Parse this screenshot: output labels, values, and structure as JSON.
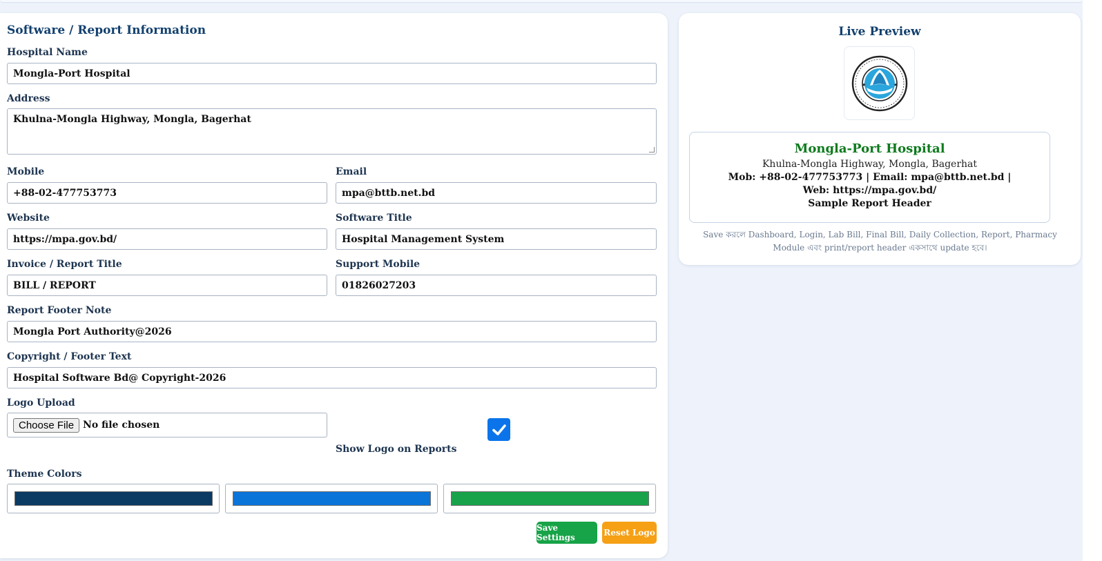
{
  "form": {
    "section_title": "Software / Report Information",
    "hospital_name": {
      "label": "Hospital Name",
      "value": "Mongla-Port Hospital"
    },
    "address": {
      "label": "Address",
      "value": "Khulna-Mongla Highway, Mongla, Bagerhat"
    },
    "mobile": {
      "label": "Mobile",
      "value": "+88-02-477753773"
    },
    "email": {
      "label": "Email",
      "value": "mpa@bttb.net.bd"
    },
    "website": {
      "label": "Website",
      "value": "https://mpa.gov.bd/"
    },
    "software_title": {
      "label": "Software Title",
      "value": "Hospital Management System"
    },
    "invoice_title": {
      "label": "Invoice / Report Title",
      "value": "BILL / REPORT"
    },
    "support_mobile": {
      "label": "Support Mobile",
      "value": "01826027203"
    },
    "footer_note": {
      "label": "Report Footer Note",
      "value": "Mongla Port Authority@2026"
    },
    "copyright": {
      "label": "Copyright / Footer Text",
      "value": "Hospital Software Bd@ Copyright-2026"
    },
    "logo_upload": {
      "label": "Logo Upload",
      "button": "Choose File",
      "status": "No file chosen"
    },
    "show_logo": {
      "label": "Show Logo on Reports",
      "checked": true
    },
    "theme_colors": {
      "label": "Theme Colors",
      "colors": [
        "#0b3a63",
        "#0b74d9",
        "#18a34a"
      ]
    },
    "save_button": "Save Settings",
    "reset_button": "Reset Logo"
  },
  "preview": {
    "title": "Live Preview",
    "logo_icon": "mongla-port-authority-seal",
    "hospital_name": "Mongla-Port Hospital",
    "address": "Khulna-Mongla Highway, Mongla, Bagerhat",
    "contact_line": "Mob: +88-02-477753773 | Email: mpa@bttb.net.bd | Web: https://mpa.gov.bd/",
    "sample_header": "Sample Report Header",
    "note": "Save করলে Dashboard, Login, Lab Bill, Final Bill, Daily Collection, Report, Pharmacy Module এবং print/report header একসাথে update হবে।"
  },
  "colors": {
    "accent_blue": "#12406e",
    "preview_name_green": "#0d7a1d",
    "save_button_bg": "#17a347",
    "reset_button_bg": "#f5a015",
    "checkbox_blue": "#0b74ea"
  }
}
